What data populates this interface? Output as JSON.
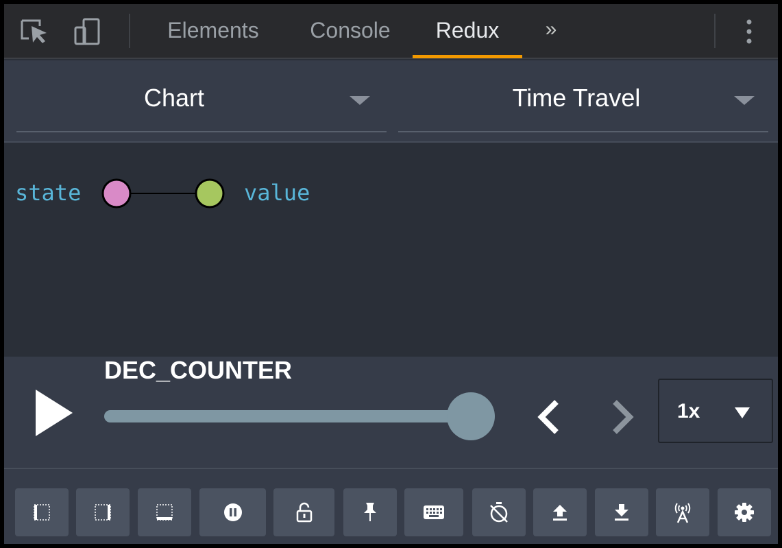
{
  "devtools": {
    "tabs": [
      {
        "label": "Elements",
        "active": false
      },
      {
        "label": "Console",
        "active": false
      },
      {
        "label": "Redux",
        "active": true
      }
    ],
    "more_label": "»",
    "icons": {
      "inspect": "inspect-element-icon",
      "device": "device-toolbar-icon",
      "menu": "kebab-menu-icon"
    },
    "accent_color": "#f29900"
  },
  "selectors": {
    "monitor": "Chart",
    "mode": "Time Travel"
  },
  "tree": {
    "nodes": [
      {
        "label": "state",
        "color": "#d98ac7"
      },
      {
        "label": "value",
        "color": "#a6c75f"
      }
    ]
  },
  "player": {
    "action": "DEC_COUNTER",
    "position_fraction": 1.0,
    "speed": "1x",
    "icons": {
      "play": "play-icon",
      "previous": "chevron-left-icon",
      "next": "chevron-right-icon"
    }
  },
  "toolbar": {
    "buttons": [
      {
        "icon": "dock-left-icon"
      },
      {
        "icon": "dock-right-icon"
      },
      {
        "icon": "dock-bottom-icon"
      },
      {
        "icon": "pause-recording-icon"
      },
      {
        "icon": "lock-icon"
      },
      {
        "icon": "pin-icon"
      },
      {
        "icon": "keyboard-icon"
      },
      {
        "icon": "timer-off-icon"
      },
      {
        "icon": "upload-icon"
      },
      {
        "icon": "download-icon"
      },
      {
        "icon": "remote-broadcast-icon"
      },
      {
        "icon": "settings-gear-icon"
      }
    ]
  }
}
